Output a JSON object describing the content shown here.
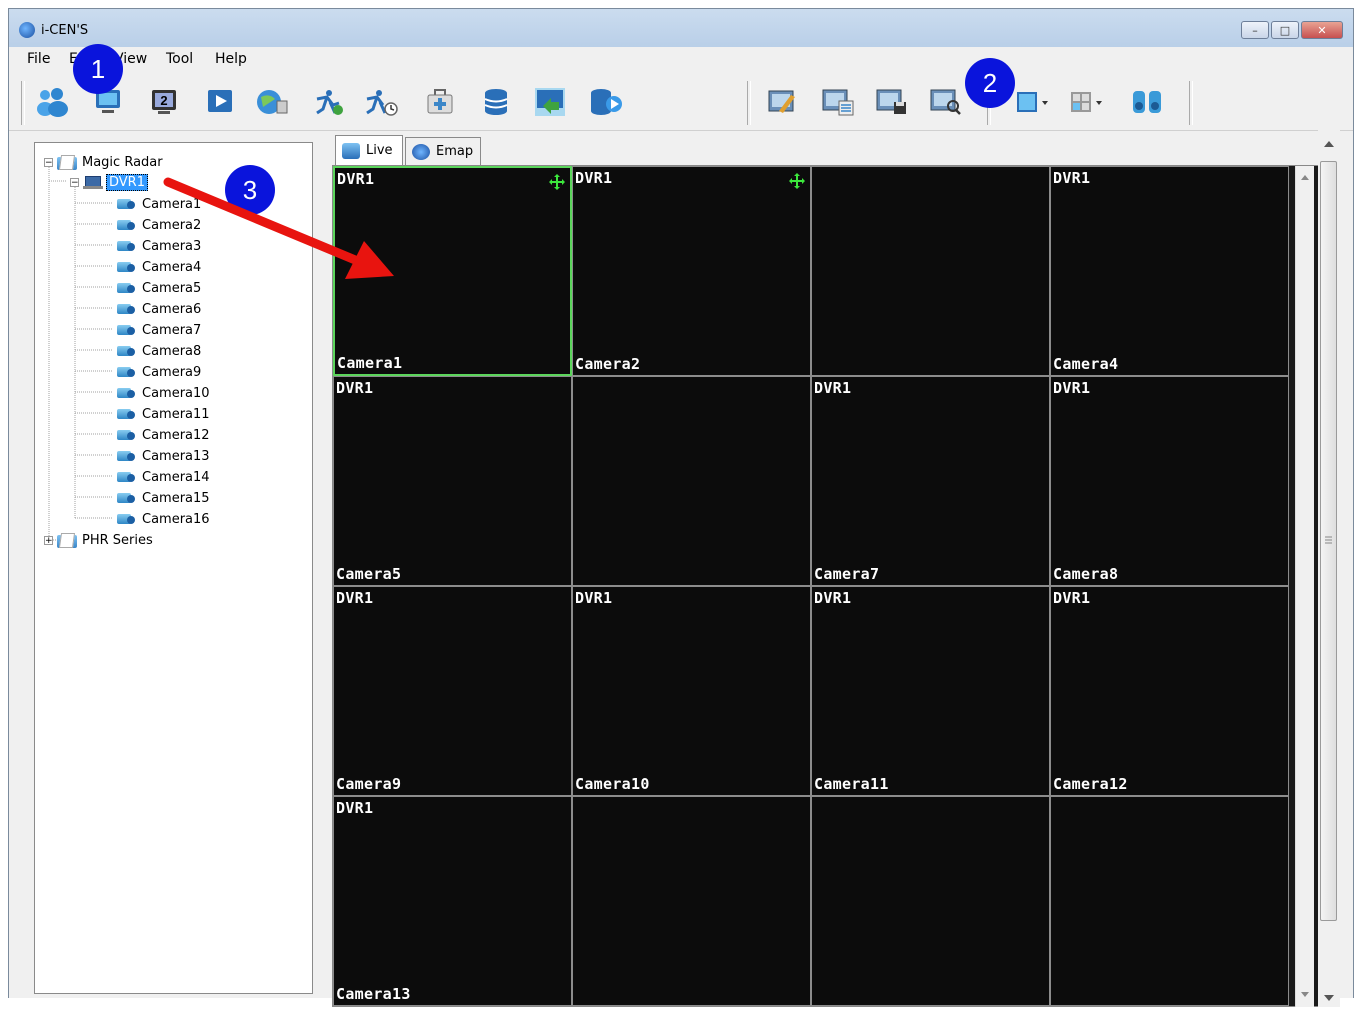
{
  "window": {
    "title": "i-CEN'S",
    "minimize": "–",
    "maximize": "□",
    "close": "✕"
  },
  "menu": [
    "File",
    "Edit",
    "View",
    "Tool",
    "Help"
  ],
  "toolbar": {
    "left_icons": [
      "users-icon",
      "monitor-icon",
      "monitor-2-icon",
      "play-icon",
      "globe-icon",
      "runner-icon",
      "runner-clock-icon",
      "medical-kit-icon",
      "database-icon",
      "export-icon",
      "database-play-icon"
    ],
    "right_icons": [
      "image-edit-icon",
      "image-list-icon",
      "image-save-icon",
      "image-search-icon",
      "layout-grid-icon",
      "layout-split-icon",
      "binoculars-icon"
    ]
  },
  "badges": [
    "1",
    "2",
    "3"
  ],
  "tree": {
    "root": "Magic Radar",
    "dvr": "DVR1",
    "cameras": [
      "Camera1",
      "Camera2",
      "Camera3",
      "Camera4",
      "Camera5",
      "Camera6",
      "Camera7",
      "Camera8",
      "Camera9",
      "Camera10",
      "Camera11",
      "Camera12",
      "Camera13",
      "Camera14",
      "Camera15",
      "Camera16"
    ],
    "second_root": "PHR Series"
  },
  "tabs": [
    {
      "label": "Live"
    },
    {
      "label": "Emap"
    }
  ],
  "grid": [
    {
      "dvr": "DVR1",
      "camera": "Camera1",
      "move": true,
      "selected": true
    },
    {
      "dvr": "DVR1",
      "camera": "Camera2",
      "move": true
    },
    {
      "dvr": "",
      "camera": ""
    },
    {
      "dvr": "DVR1",
      "camera": "Camera4"
    },
    {
      "dvr": "DVR1",
      "camera": "Camera5"
    },
    {
      "dvr": "",
      "camera": ""
    },
    {
      "dvr": "DVR1",
      "camera": "Camera7"
    },
    {
      "dvr": "DVR1",
      "camera": "Camera8"
    },
    {
      "dvr": "DVR1",
      "camera": "Camera9"
    },
    {
      "dvr": "DVR1",
      "camera": "Camera10"
    },
    {
      "dvr": "DVR1",
      "camera": "Camera11"
    },
    {
      "dvr": "DVR1",
      "camera": "Camera12"
    },
    {
      "dvr": "DVR1",
      "camera": "Camera13"
    },
    {
      "dvr": "",
      "camera": ""
    },
    {
      "dvr": "",
      "camera": ""
    },
    {
      "dvr": "",
      "camera": ""
    }
  ],
  "colors": {
    "badge": "#0a14dc",
    "selected_border": "#5cd65c",
    "arrow": "#e8140f",
    "cell_bg": "#0c0c0c"
  }
}
